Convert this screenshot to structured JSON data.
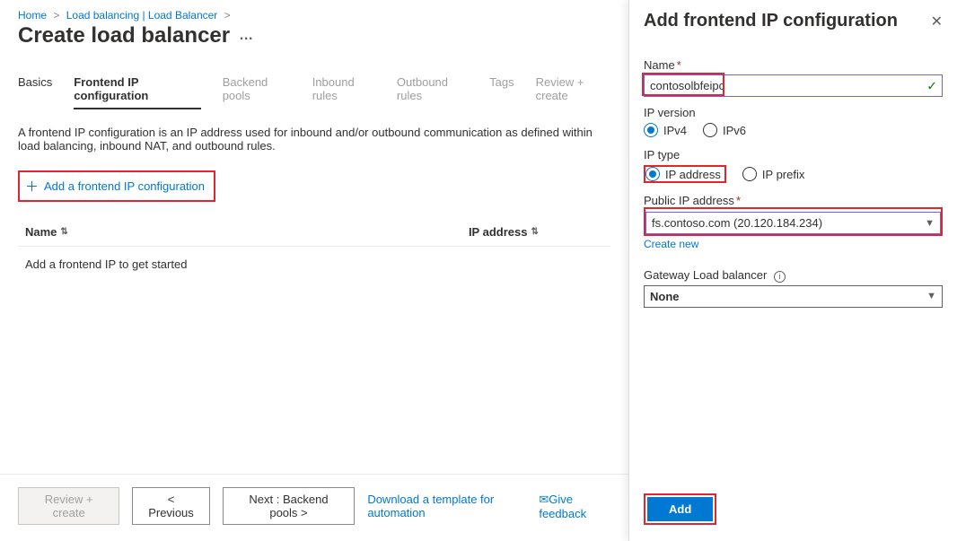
{
  "breadcrumb": {
    "home": "Home",
    "lb": "Load balancing | Load Balancer"
  },
  "page_title": "Create load balancer",
  "tabs": {
    "basics": "Basics",
    "frontend": "Frontend IP configuration",
    "backend": "Backend pools",
    "inbound": "Inbound rules",
    "outbound": "Outbound rules",
    "tags": "Tags",
    "review": "Review + create"
  },
  "intro": "A frontend IP configuration is an IP address used for inbound and/or outbound communication as defined within load balancing, inbound NAT, and outbound rules.",
  "add_btn": "Add a frontend IP configuration",
  "table": {
    "name_col": "Name",
    "ip_col": "IP address",
    "empty": "Add a frontend IP to get started"
  },
  "footer": {
    "review": "Review + create",
    "prev": "< Previous",
    "next": "Next : Backend pools >",
    "template": "Download a template for automation",
    "feedback": "Give feedback"
  },
  "blade": {
    "title": "Add frontend IP configuration",
    "name_label": "Name",
    "name_value": "contosolbfeipc",
    "ipver_label": "IP version",
    "ipv4": "IPv4",
    "ipv6": "IPv6",
    "iptype_label": "IP type",
    "ip_addr": "IP address",
    "ip_prefix": "IP prefix",
    "pubip_label": "Public IP address",
    "pubip_value": "fs.contoso.com (20.120.184.234)",
    "create_new": "Create new",
    "gw_label": "Gateway Load balancer",
    "gw_value": "None",
    "add": "Add"
  }
}
